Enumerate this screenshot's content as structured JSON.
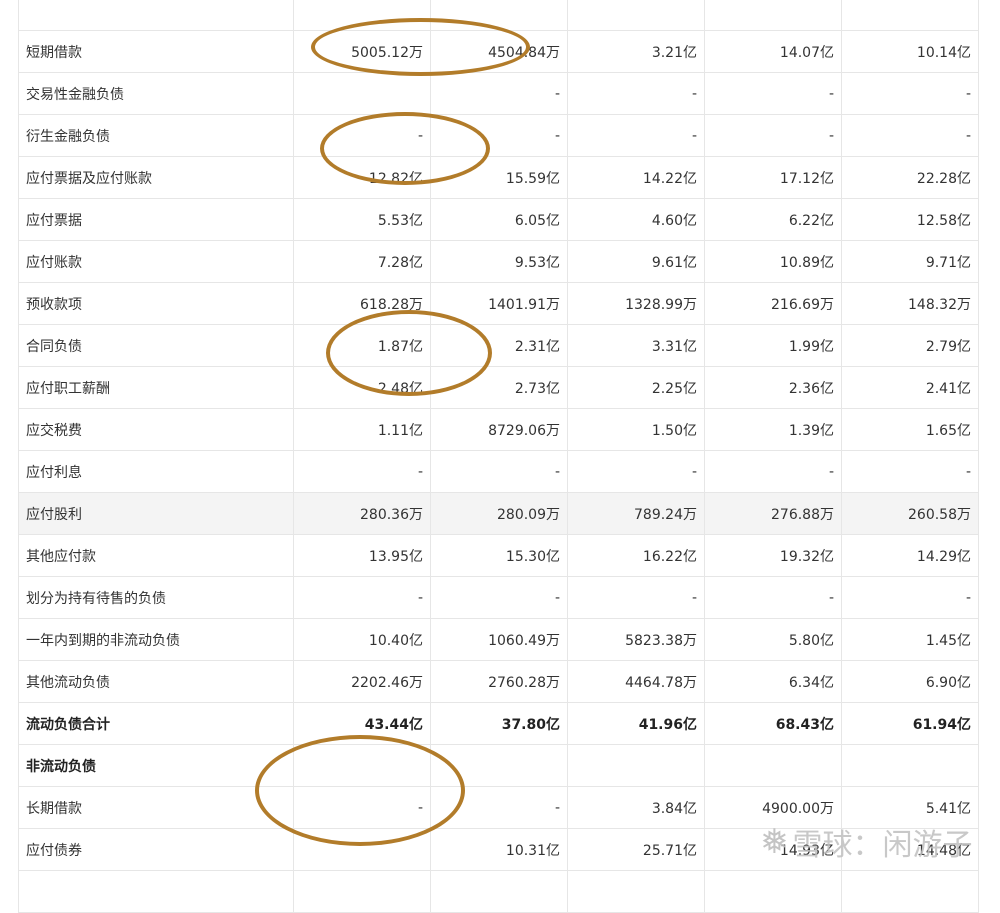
{
  "colors": {
    "annotation": "#b27c2a",
    "row_highlight": "#f4f4f4",
    "border": "#e6e6e6"
  },
  "table": {
    "rows": [
      {
        "name": "",
        "values": [
          "",
          "",
          "",
          "",
          ""
        ],
        "style": ""
      },
      {
        "name": "短期借款",
        "values": [
          "5005.12万",
          "4504.84万",
          "3.21亿",
          "14.07亿",
          "10.14亿"
        ],
        "style": ""
      },
      {
        "name": "交易性金融负债",
        "values": [
          "",
          "-",
          "-",
          "-",
          "-"
        ],
        "style": ""
      },
      {
        "name": "衍生金融负债",
        "values": [
          "-",
          "-",
          "-",
          "-",
          "-"
        ],
        "style": ""
      },
      {
        "name": "应付票据及应付账款",
        "values": [
          "12.82亿",
          "15.59亿",
          "14.22亿",
          "17.12亿",
          "22.28亿"
        ],
        "style": ""
      },
      {
        "name": "应付票据",
        "values": [
          "5.53亿",
          "6.05亿",
          "4.60亿",
          "6.22亿",
          "12.58亿"
        ],
        "style": ""
      },
      {
        "name": "应付账款",
        "values": [
          "7.28亿",
          "9.53亿",
          "9.61亿",
          "10.89亿",
          "9.71亿"
        ],
        "style": ""
      },
      {
        "name": "预收款项",
        "values": [
          "618.28万",
          "1401.91万",
          "1328.99万",
          "216.69万",
          "148.32万"
        ],
        "style": ""
      },
      {
        "name": "合同负债",
        "values": [
          "1.87亿",
          "2.31亿",
          "3.31亿",
          "1.99亿",
          "2.79亿"
        ],
        "style": ""
      },
      {
        "name": "应付职工薪酬",
        "values": [
          "2.48亿",
          "2.73亿",
          "2.25亿",
          "2.36亿",
          "2.41亿"
        ],
        "style": ""
      },
      {
        "name": "应交税费",
        "values": [
          "1.11亿",
          "8729.06万",
          "1.50亿",
          "1.39亿",
          "1.65亿"
        ],
        "style": ""
      },
      {
        "name": "应付利息",
        "values": [
          "-",
          "-",
          "-",
          "-",
          "-"
        ],
        "style": ""
      },
      {
        "name": "应付股利",
        "values": [
          "280.36万",
          "280.09万",
          "789.24万",
          "276.88万",
          "260.58万"
        ],
        "style": "highlight"
      },
      {
        "name": "其他应付款",
        "values": [
          "13.95亿",
          "15.30亿",
          "16.22亿",
          "19.32亿",
          "14.29亿"
        ],
        "style": ""
      },
      {
        "name": "划分为持有待售的负债",
        "values": [
          "-",
          "-",
          "-",
          "-",
          "-"
        ],
        "style": ""
      },
      {
        "name": "一年内到期的非流动负债",
        "values": [
          "10.40亿",
          "1060.49万",
          "5823.38万",
          "5.80亿",
          "1.45亿"
        ],
        "style": ""
      },
      {
        "name": "其他流动负债",
        "values": [
          "2202.46万",
          "2760.28万",
          "4464.78万",
          "6.34亿",
          "6.90亿"
        ],
        "style": ""
      },
      {
        "name": "流动负债合计",
        "values": [
          "43.44亿",
          "37.80亿",
          "41.96亿",
          "68.43亿",
          "61.94亿"
        ],
        "style": "bold"
      },
      {
        "name": "非流动负债",
        "values": [
          "",
          "",
          "",
          "",
          ""
        ],
        "style": "bold"
      },
      {
        "name": "长期借款",
        "values": [
          "-",
          "-",
          "3.84亿",
          "4900.00万",
          "5.41亿"
        ],
        "style": ""
      },
      {
        "name": "应付债券",
        "values": [
          "",
          "10.31亿",
          "25.71亿",
          "14.93亿",
          "14.48亿"
        ],
        "style": ""
      },
      {
        "name": "",
        "values": [
          "",
          "",
          "",
          "",
          ""
        ],
        "style": ""
      }
    ]
  },
  "watermark": {
    "text": "雪球：闲游子",
    "icon": "snowflake-icon"
  }
}
